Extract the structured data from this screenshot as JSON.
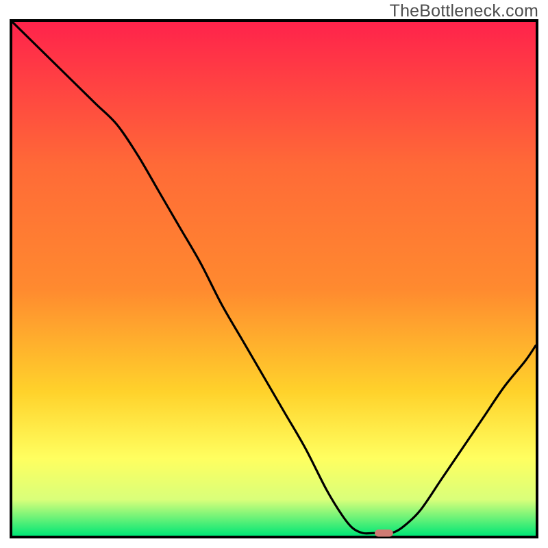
{
  "watermark": "TheBottleneck.com",
  "chart_data": {
    "type": "line",
    "title": "",
    "xlabel": "",
    "ylabel": "",
    "xlim": [
      0,
      100
    ],
    "ylim": [
      0,
      100
    ],
    "grid": false,
    "legend": false,
    "background_gradient": {
      "top": "#ff234b",
      "mid_upper": "#ff8a2f",
      "mid": "#ffd22b",
      "mid_lower": "#ffff60",
      "near_bottom": "#d9ff7a",
      "bottom": "#00e676"
    },
    "series": [
      {
        "name": "curve",
        "type": "line",
        "color": "#000000",
        "points_xy": [
          [
            0,
            100
          ],
          [
            4,
            96
          ],
          [
            8,
            92
          ],
          [
            12,
            88
          ],
          [
            16,
            84
          ],
          [
            20,
            80
          ],
          [
            24,
            74
          ],
          [
            28,
            67
          ],
          [
            32,
            60
          ],
          [
            36,
            53
          ],
          [
            40,
            45
          ],
          [
            44,
            38
          ],
          [
            48,
            31
          ],
          [
            52,
            24
          ],
          [
            56,
            17
          ],
          [
            60,
            9
          ],
          [
            63,
            4
          ],
          [
            65,
            1.5
          ],
          [
            67,
            0.5
          ],
          [
            69,
            0.5
          ],
          [
            71,
            0.5
          ],
          [
            73,
            0.7
          ],
          [
            75,
            2
          ],
          [
            78,
            5
          ],
          [
            82,
            11
          ],
          [
            86,
            17
          ],
          [
            90,
            23
          ],
          [
            94,
            29
          ],
          [
            98,
            34
          ],
          [
            100,
            37
          ]
        ]
      },
      {
        "name": "marker",
        "type": "point",
        "color": "#cf7b74",
        "shape": "rounded-rect",
        "x": 71,
        "y": 0.5,
        "width_pct": 3.5,
        "height_pct": 1.4
      }
    ],
    "annotations": []
  }
}
